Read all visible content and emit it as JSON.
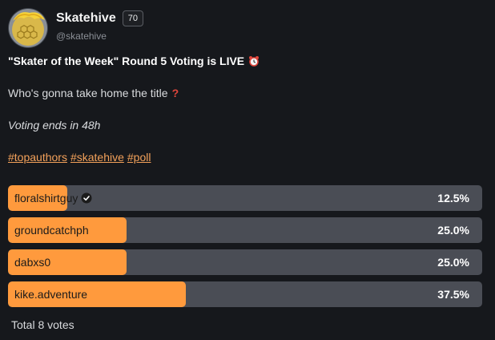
{
  "author": {
    "display_name": "Skatehive",
    "level": "70",
    "handle": "@skatehive"
  },
  "post": {
    "title": "\"Skater of the Week\" Round 5 Voting is LIVE",
    "title_icon": "alarm-clock-icon",
    "question": "Who's gonna take home the title",
    "question_icon": "red-question-mark-icon",
    "voting_note": "Voting ends in 48h",
    "tags": [
      "#topauthors",
      "#skatehive",
      "#poll"
    ]
  },
  "poll": {
    "options": [
      {
        "label": "floralshirtguy",
        "percent_text": "12.5%",
        "fraction": 0.125,
        "voted": true
      },
      {
        "label": "groundcatchph",
        "percent_text": "25.0%",
        "fraction": 0.25,
        "voted": false
      },
      {
        "label": "dabxs0",
        "percent_text": "25.0%",
        "fraction": 0.25,
        "voted": false
      },
      {
        "label": "kike.adventure",
        "percent_text": "37.5%",
        "fraction": 0.375,
        "voted": false
      }
    ],
    "total_text": "Total 8 votes"
  },
  "colors": {
    "background": "#16181c",
    "bar_track": "#4a4d55",
    "bar_fill": "#ff9a3d",
    "tag_link": "#f3a15a"
  }
}
